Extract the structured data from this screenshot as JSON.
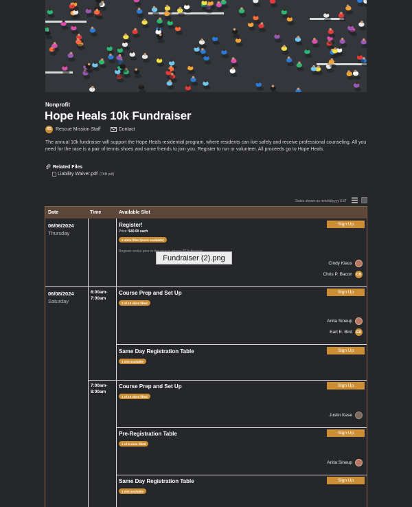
{
  "header": {
    "category": "Nonprofit",
    "title": "Hope Heals 10k Fundraiser",
    "organizer": "Rescue Mission Staff",
    "organizer_initials": "RS",
    "contact_label": "Contact",
    "description": "The annual 10k fundraiser will support the Hope Heals residential program, where residents can live safely and receive professional counseling. All you need for the race is a pair of tennis shoes and some friends to join you. Register to run or volunteer. All proceeds go to Hope Heals."
  },
  "files": {
    "heading": "Related Files",
    "items": [
      {
        "name": "Liability Waiver.pdf",
        "size": "(7KB pdf)"
      }
    ]
  },
  "dates_note": "Dates shown as mm/dd/yyyy EST",
  "table": {
    "headers": {
      "date": "Date",
      "time": "Time",
      "slot": "Available Slot"
    },
    "rows": [
      {
        "date": "06/06/2024",
        "dow": "Thursday",
        "slots": [
          {
            "title": "Register!",
            "price_label": "Price:",
            "price": "$40.00 each",
            "badge": "2 slots filled (more available)",
            "note": "Register online prior to the race to ensure $10 discount",
            "button": "Sign Up",
            "people": [
              {
                "name": "Cindy Klaus",
                "initials": ""
              },
              {
                "name": "Chris P. Bacon",
                "initials": "CB"
              }
            ]
          }
        ]
      },
      {
        "date": "06/08/2024",
        "dow": "Saturday",
        "groups": [
          {
            "time": "6:00am-\n7:00am",
            "slots": [
              {
                "title": "Course Prep and Set Up",
                "badge": "2 of 10 slots filled",
                "button": "Sign Up",
                "people": [
                  {
                    "name": "Anita Sineup",
                    "initials": ""
                  },
                  {
                    "name": "Earl E. Bird",
                    "initials": "EB"
                  }
                ]
              },
              {
                "title": "Same Day Registration Table",
                "badge": "1 slot available",
                "button": "Sign Up",
                "people": []
              }
            ]
          },
          {
            "time": "7:00am-\n8:00am",
            "slots": [
              {
                "title": "Course Prep and Set Up",
                "badge": "1 of 10 slots filled",
                "button": "Sign Up",
                "people": [
                  {
                    "name": "Justin Kase",
                    "initials": ""
                  }
                ]
              },
              {
                "title": "Pre-Registration Table",
                "badge": "1 of 8 slots filled",
                "button": "Sign Up",
                "people": [
                  {
                    "name": "Anita Sineup",
                    "initials": ""
                  }
                ]
              },
              {
                "title": "Same Day Registration Table",
                "badge": "1 slot available",
                "button": "Sign Up",
                "people": []
              }
            ]
          }
        ]
      }
    ]
  },
  "tooltip": "Fundraiser (2).png",
  "colors": {
    "accent": "#cc8e35",
    "header_bg": "#5c4637",
    "page_bg": "#25272a"
  }
}
